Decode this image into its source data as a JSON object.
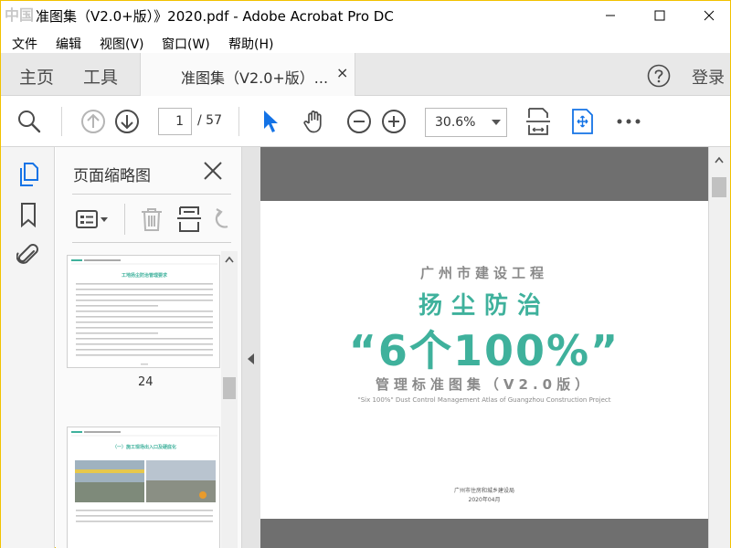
{
  "window": {
    "logo_text": "中国",
    "title": "准图集（V2.0+版）》2020.pdf - Adobe Acrobat Pro DC"
  },
  "menu": {
    "items": [
      "文件",
      "编辑",
      "视图(V)",
      "窗口(W)",
      "帮助(H)"
    ]
  },
  "tabs": {
    "home": "主页",
    "tools": "工具",
    "document_tab": "准图集（V2.0+版）...",
    "close_glyph": "×",
    "login": "登录"
  },
  "toolbar": {
    "current_page": "1",
    "total_pages": "/ 57",
    "zoom": "30.6%"
  },
  "thumb_panel": {
    "title": "页面缩略图",
    "thumbnails": [
      {
        "page_label": "24",
        "heading": "工地扬尘防治管理要求",
        "body_lines": 14
      },
      {
        "page_label": "",
        "heading": "（一）施工现场出入口及硬底化",
        "body_lines": 3
      }
    ]
  },
  "document": {
    "line1": "广州市建设工程",
    "line2": "扬尘防治",
    "line3": "“6个100%”",
    "line4": "管理标准图集（V2.0版）",
    "line5": "\"Six 100%\" Dust Control Management Atlas  of Guangzhou Construction Project",
    "publisher": "广州市住房和城乡建设局",
    "date": "2020年04月"
  },
  "colors": {
    "accent_blue": "#1473e6",
    "pdf_green": "#3fb19c",
    "pdf_grey": "#8a8a8a",
    "window_border": "#f2c200"
  },
  "icons": {
    "search": "search-icon",
    "prev_page": "arrow-up-circle-icon",
    "next_page": "arrow-down-circle-icon",
    "select": "cursor-arrow-icon",
    "hand": "hand-icon",
    "zoom_out": "minus-circle-icon",
    "zoom_in": "plus-circle-icon",
    "fit_page": "fit-page-icon",
    "full_screen": "full-screen-icon",
    "more": "more-icon"
  }
}
